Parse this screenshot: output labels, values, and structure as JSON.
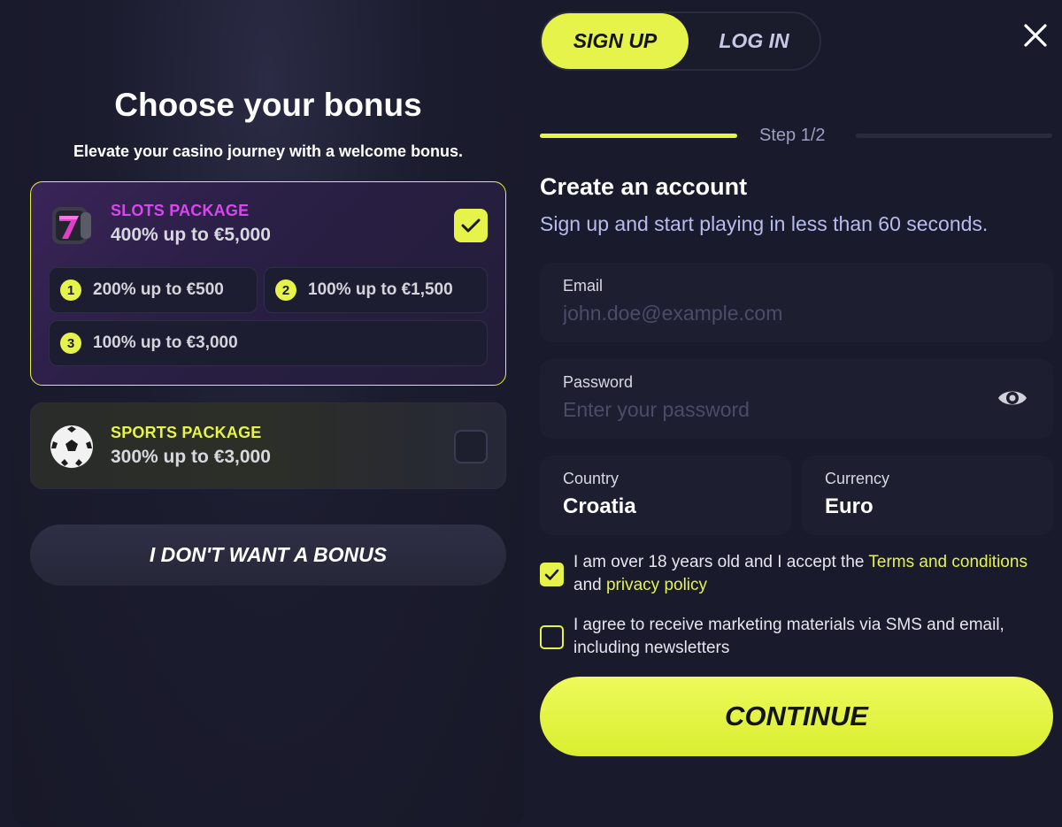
{
  "bonus": {
    "title": "Choose your bonus",
    "subtitle": "Elevate your casino journey with a welcome bonus.",
    "packages": [
      {
        "name": "SLOTS PACKAGE",
        "value": "400% up to €5,000",
        "name_color": "#d946ef",
        "icon": "slot-seven-icon",
        "selected": true,
        "tiers": [
          {
            "num": "1",
            "text": "200% up to €500"
          },
          {
            "num": "2",
            "text": "100% up to €1,500"
          },
          {
            "num": "3",
            "text": "100% up to €3,000"
          }
        ]
      },
      {
        "name": "SPORTS PACKAGE",
        "value": "300% up to €3,000",
        "name_color": "#e6f34a",
        "icon": "soccer-ball-icon",
        "selected": false
      }
    ],
    "no_bonus_label": "I DON'T WANT A BONUS"
  },
  "tabs": {
    "signup": "SIGN UP",
    "login": "LOG IN",
    "active": "signup"
  },
  "step": {
    "label": "Step 1/2",
    "current": 1,
    "total": 2
  },
  "form": {
    "title": "Create an account",
    "subtitle": "Sign up and start playing in less than 60 seconds.",
    "email": {
      "label": "Email",
      "placeholder": "john.doe@example.com",
      "value": ""
    },
    "password": {
      "label": "Password",
      "placeholder": "Enter your password",
      "value": ""
    },
    "country": {
      "label": "Country",
      "value": "Croatia"
    },
    "currency": {
      "label": "Currency",
      "value": "Euro"
    },
    "terms": {
      "checked": true,
      "text_before": "I am over 18 years old and I accept the ",
      "terms_link": "Terms and conditions",
      "text_and": "and ",
      "privacy_link": "privacy policy"
    },
    "marketing": {
      "checked": false,
      "line1": "I agree to receive marketing materials via SMS and email,",
      "line2": "including newsletters"
    },
    "continue_label": "CONTINUE"
  },
  "colors": {
    "accent": "#e6f34a",
    "background": "#191a2b",
    "slots_accent": "#d946ef"
  }
}
